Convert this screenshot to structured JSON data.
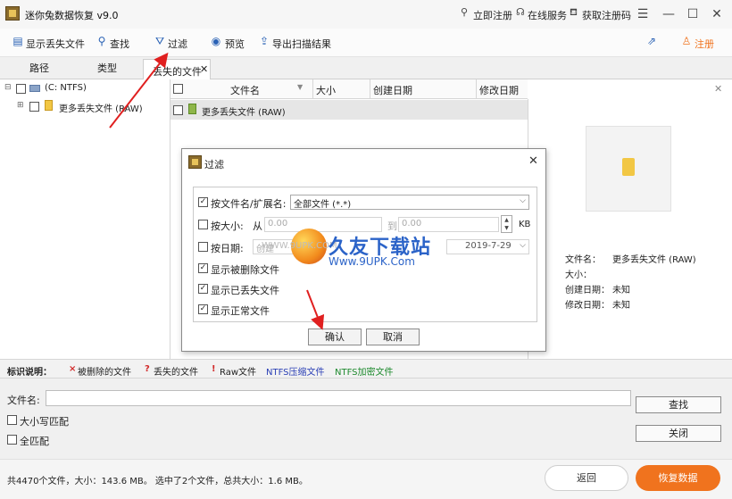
{
  "title_bar": {
    "title": "迷你兔数据恢复 v9.0",
    "links": [
      "立即注册",
      "在线服务",
      "获取注册码"
    ]
  },
  "toolbar": {
    "show_lost": "显示丢失文件",
    "find": "查找",
    "filter": "过滤",
    "preview": "预览",
    "export": "导出扫描结果",
    "register": "注册"
  },
  "tabs": {
    "path": "路径",
    "type": "类型",
    "lost": "丢失的文件"
  },
  "tree": {
    "drive": "(C: NTFS)",
    "folder": "更多丢失文件 (RAW)"
  },
  "file_list": {
    "columns": [
      "文件名",
      "大小",
      "创建日期",
      "修改日期"
    ],
    "rows": [
      {
        "name": "更多丢失文件 (RAW)"
      }
    ]
  },
  "preview": {
    "labels": [
      "文件名：",
      "大小：",
      "创建日期：",
      "修改日期："
    ],
    "values": [
      "更多丢失文件 (RAW)",
      "",
      "未知",
      "未知"
    ]
  },
  "dialog": {
    "title": "过滤",
    "by_name_label": "按文件名/扩展名:",
    "by_name_value": "全部文件 (*.*)",
    "by_size_label": "按大小:",
    "from_label": "从",
    "from_value": "0.00",
    "to_label": "到",
    "to_value": "0.00",
    "size_unit": "KB",
    "by_date_label": "按日期:",
    "date_field_value": "创建",
    "date_end": "2019-7-29",
    "show_deleted": "显示被删除文件",
    "show_lost": "显示已丢失文件",
    "show_normal": "显示正常文件",
    "ok": "确认",
    "cancel": "取消"
  },
  "watermark": {
    "brand": "久友下载站",
    "url": "Www.9UPK.Com",
    "sub": "WWW.9UPK.COM"
  },
  "legend": {
    "label": "标识说明：",
    "deleted": "被删除的文件",
    "lost": "丢失的文件",
    "raw": "Raw文件",
    "ntfs_compressed": "NTFS压缩文件",
    "ntfs_encrypted": "NTFS加密文件",
    "colors": {
      "deleted": "#d12a2a",
      "lost": "#d12a2a",
      "compressed": "#2a3fb5",
      "encrypted": "#1e8a2e"
    }
  },
  "search": {
    "filename_label": "文件名:",
    "filename_value": "",
    "case_label": "大小写匹配",
    "whole_label": "全匹配",
    "find_button": "查找",
    "close_button": "关闭"
  },
  "status": {
    "text": "共4470个文件，大小：143.6 MB。 选中了2个文件，总共大小：1.6 MB。",
    "back": "返回",
    "recover": "恢复数据"
  },
  "colors": {
    "accent": "#f0731e",
    "link_blue": "#2a62b5"
  }
}
